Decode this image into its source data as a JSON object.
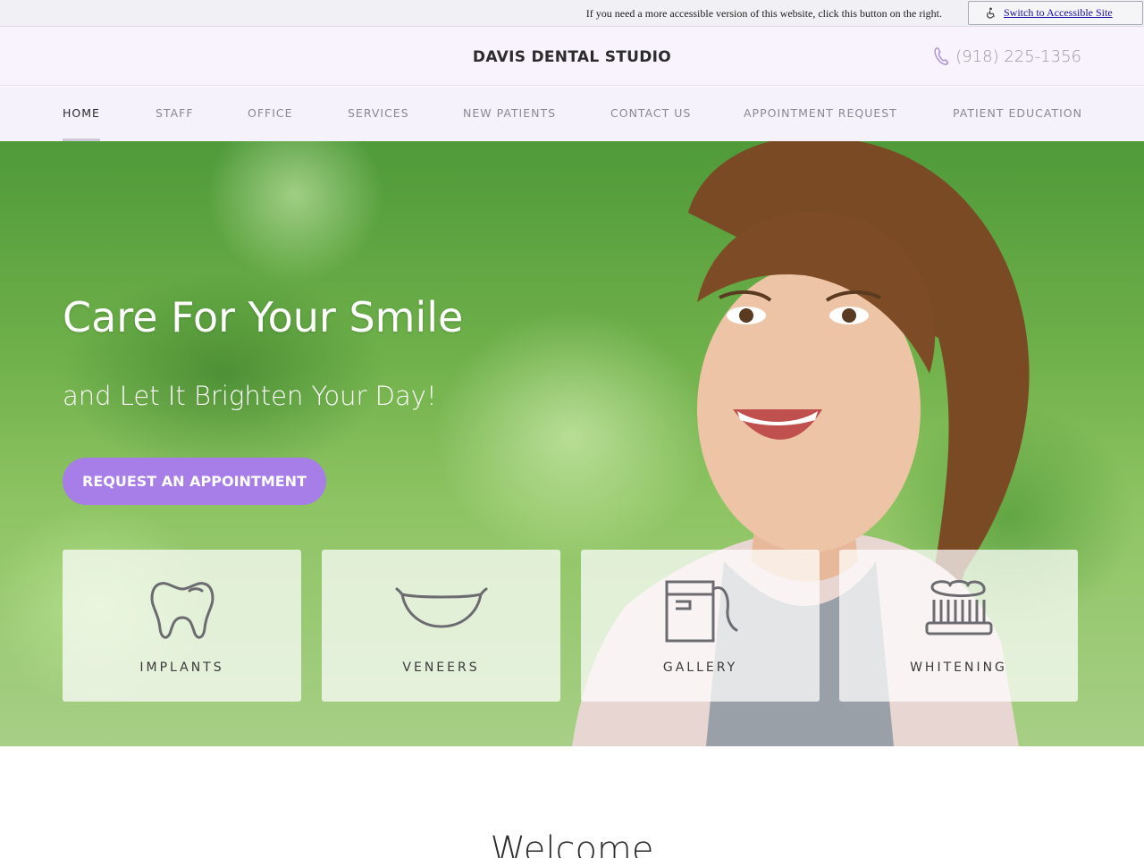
{
  "accessibility": {
    "message": "If you need a more accessible version of this website, click this button on the right.",
    "button_label": "Switch to Accessible Site"
  },
  "header": {
    "brand": "DAVIS DENTAL STUDIO",
    "phone": "(918) 225-1356"
  },
  "nav": {
    "items": [
      {
        "label": "HOME"
      },
      {
        "label": "STAFF"
      },
      {
        "label": "OFFICE"
      },
      {
        "label": "SERVICES"
      },
      {
        "label": "NEW PATIENTS"
      },
      {
        "label": "CONTACT US"
      },
      {
        "label": "APPOINTMENT REQUEST"
      },
      {
        "label": "PATIENT EDUCATION"
      }
    ],
    "active": "HOME"
  },
  "hero": {
    "title": "Care For Your Smile",
    "subtitle": "and Let It Brighten Your Day!",
    "cta_label": "REQUEST AN APPOINTMENT",
    "cards": [
      {
        "label": "IMPLANTS",
        "icon": "tooth-icon"
      },
      {
        "label": "VENEERS",
        "icon": "smile-icon"
      },
      {
        "label": "GALLERY",
        "icon": "floss-icon"
      },
      {
        "label": "WHITENING",
        "icon": "toothbrush-icon"
      }
    ]
  },
  "welcome": {
    "heading": "Welcome"
  },
  "colors": {
    "accent": "#a77de8",
    "header_bg": "#f8f3fd",
    "nav_bg": "#f6f2fb"
  }
}
